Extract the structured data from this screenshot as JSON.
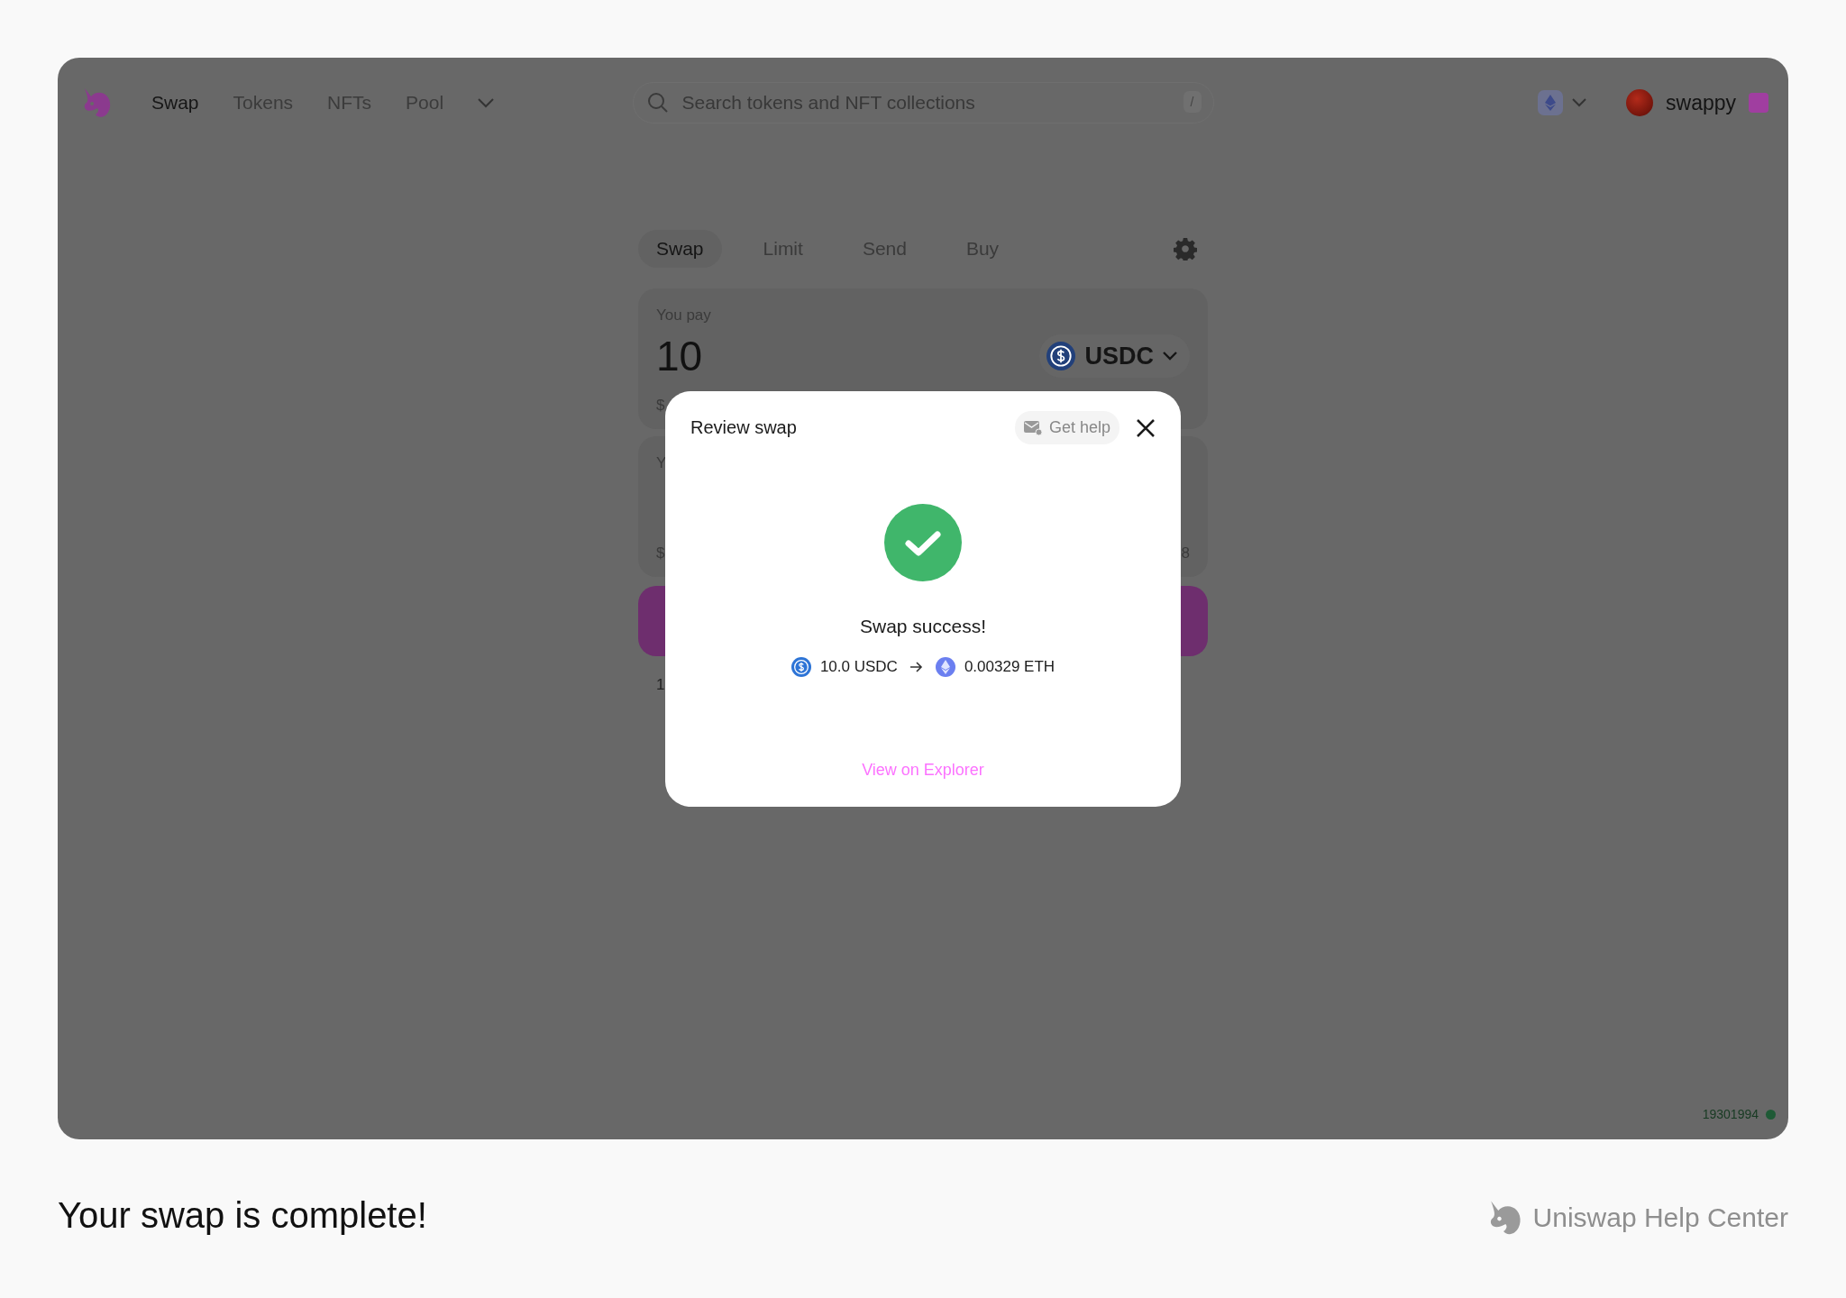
{
  "nav": {
    "items": [
      {
        "label": "Swap",
        "selected": true
      },
      {
        "label": "Tokens",
        "selected": false
      },
      {
        "label": "NFTs",
        "selected": false
      },
      {
        "label": "Pool",
        "selected": false
      }
    ],
    "search": {
      "placeholder": "Search tokens and NFT collections",
      "shortcut": "/"
    },
    "account": {
      "name": "swappy"
    }
  },
  "swap": {
    "tabs": [
      {
        "label": "Swap",
        "selected": true
      },
      {
        "label": "Limit",
        "selected": false
      },
      {
        "label": "Send",
        "selected": false
      },
      {
        "label": "Buy",
        "selected": false
      }
    ],
    "pay": {
      "label": "You pay",
      "amount": "10",
      "token": "USDC",
      "usd_fragment": "$"
    },
    "receive": {
      "label_fragment": "Y",
      "usd_fragment": "$",
      "balance_fragment": "8"
    },
    "rate_fragment": "1"
  },
  "modal": {
    "title": "Review swap",
    "help": "Get help",
    "headline": "Swap success!",
    "from": "10.0 USDC",
    "to": "0.00329 ETH",
    "link": "View on Explorer"
  },
  "status": {
    "block": "19301994"
  },
  "caption": "Your swap is complete!",
  "brand": "Uniswap Help Center"
}
